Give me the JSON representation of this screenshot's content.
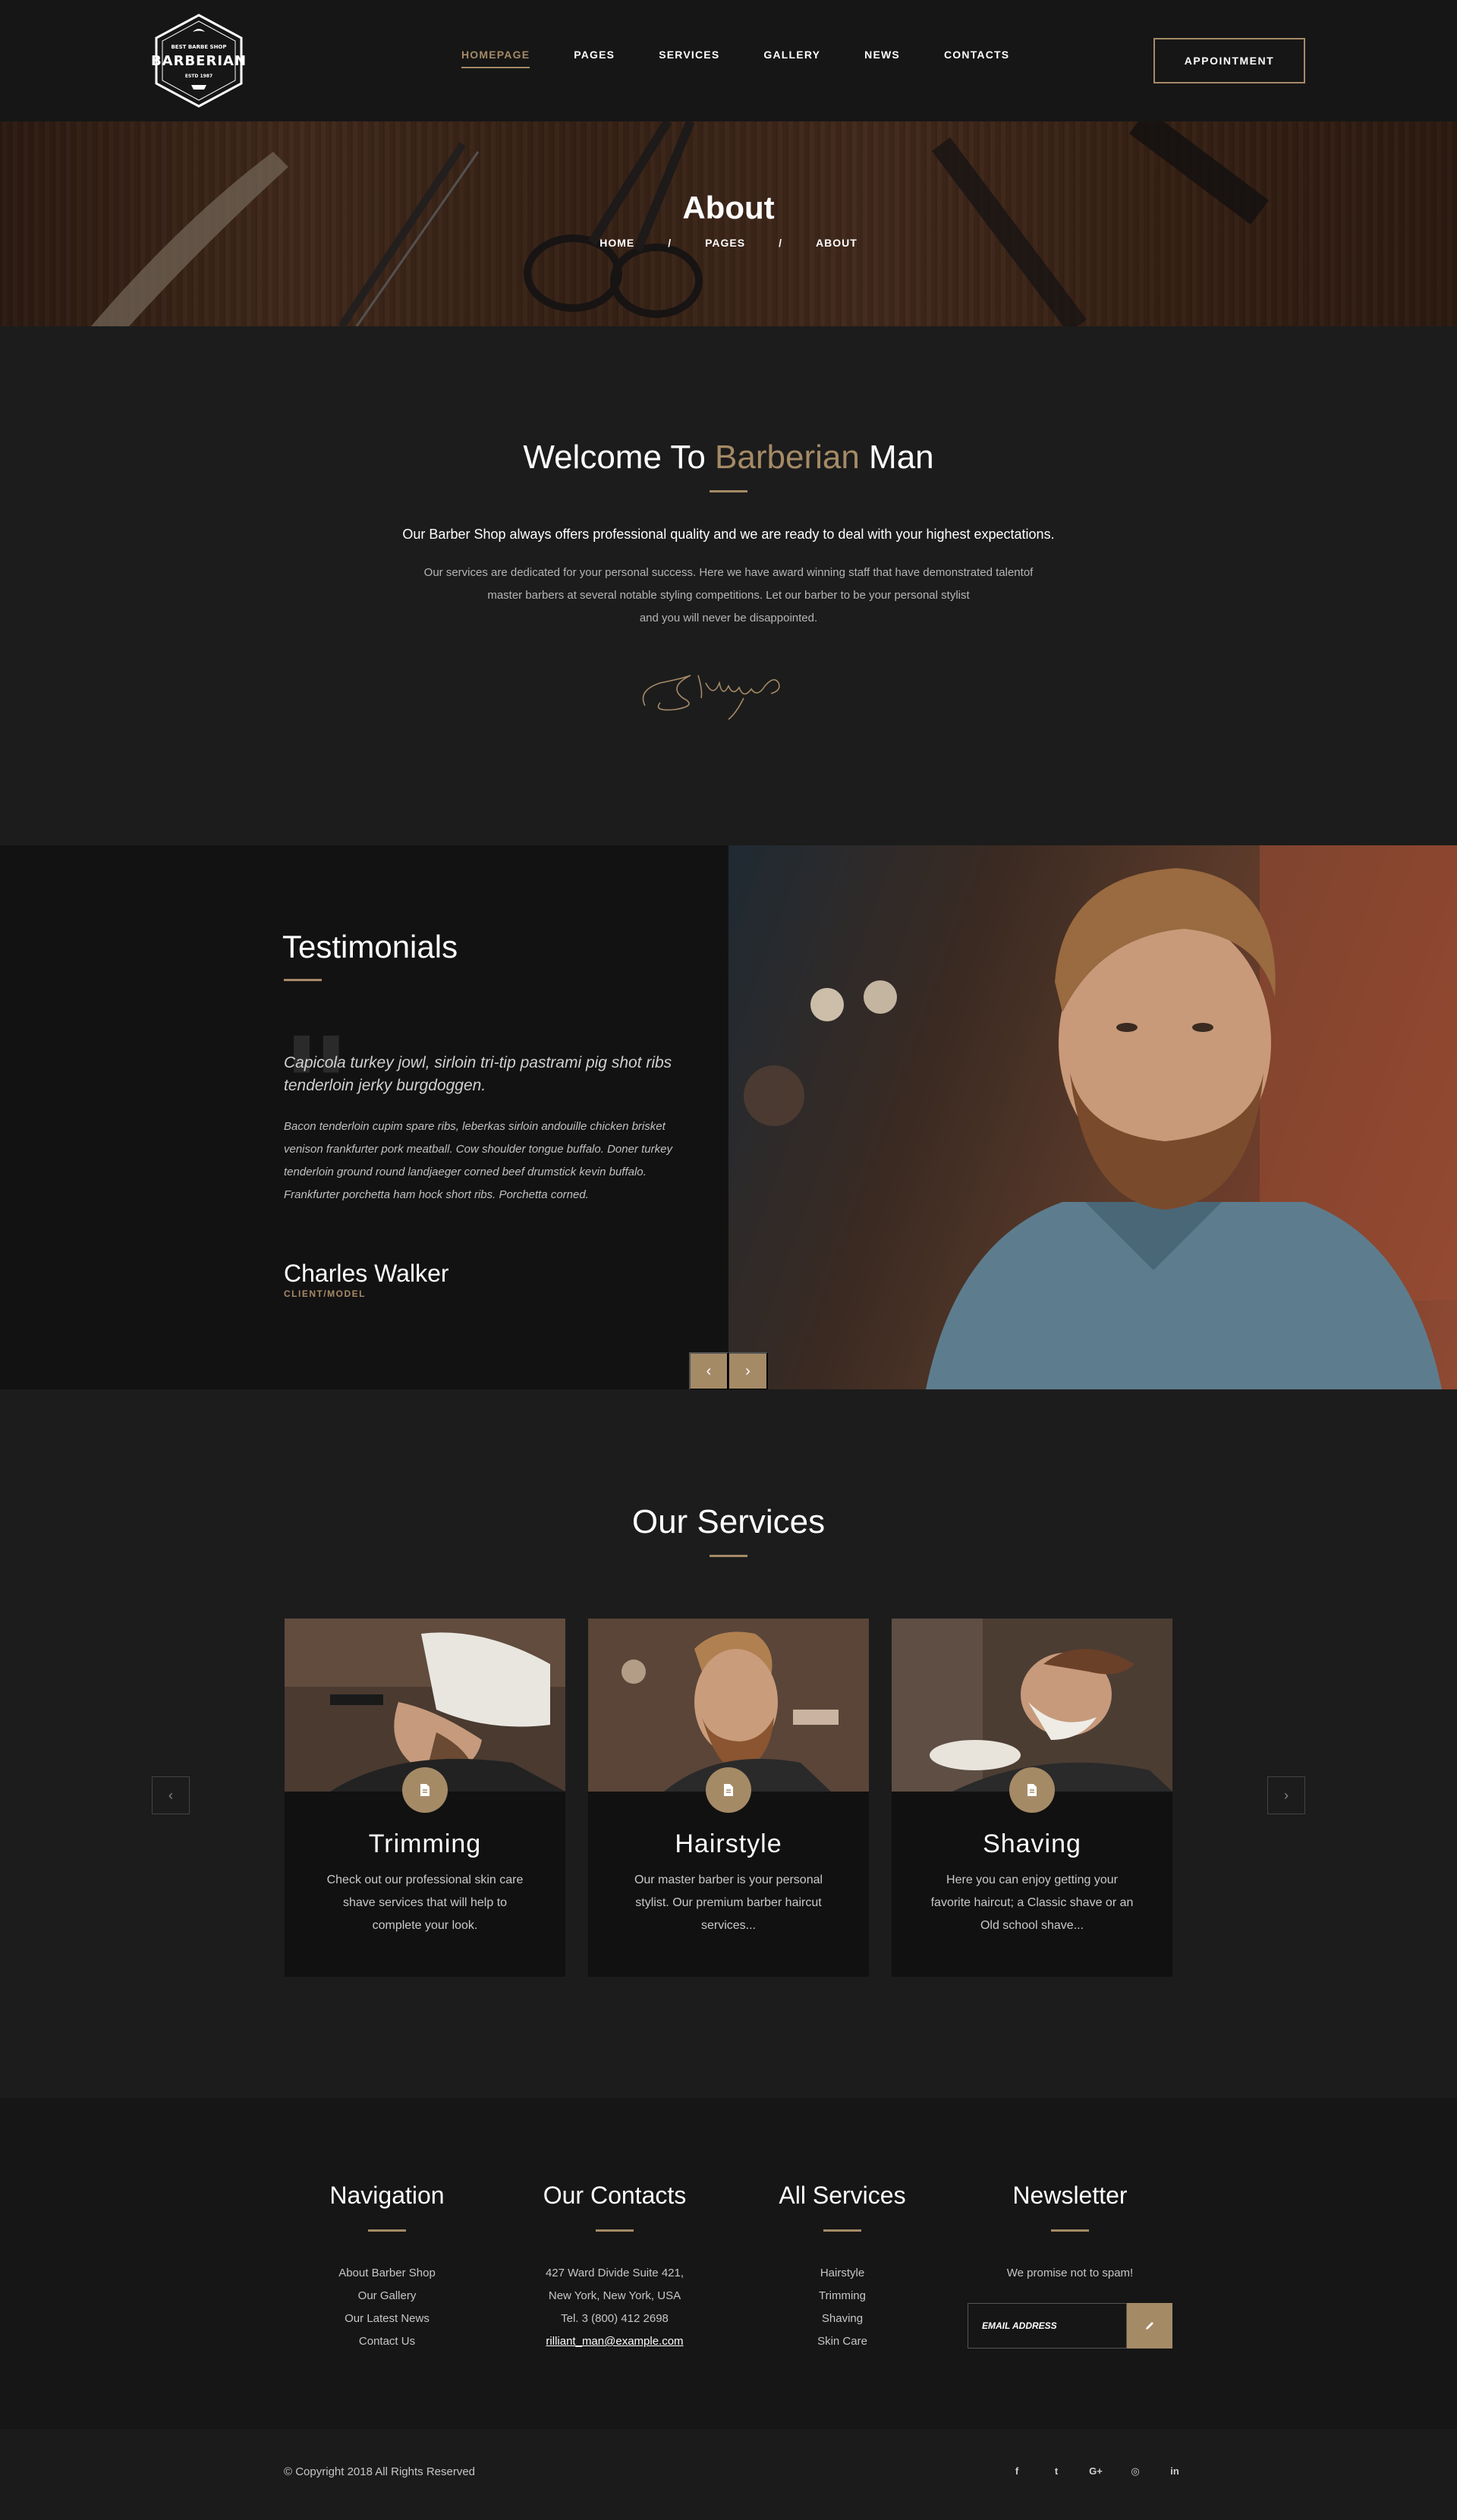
{
  "header": {
    "logo": {
      "top_text": "BEST BARBE SHOP",
      "brand": "BARBERIAN",
      "bottom_text": "ESTD 1987"
    },
    "nav": [
      {
        "label": "HOMEPAGE",
        "active": true
      },
      {
        "label": "PAGES",
        "active": false
      },
      {
        "label": "SERVICES",
        "active": false
      },
      {
        "label": "GALLERY",
        "active": false
      },
      {
        "label": "NEWS",
        "active": false
      },
      {
        "label": "CONTACTS",
        "active": false
      }
    ],
    "appointment_label": "APPOINTMENT"
  },
  "hero": {
    "title": "About",
    "breadcrumb": [
      "HOME",
      "/",
      "PAGES",
      "/",
      "ABOUT"
    ]
  },
  "welcome": {
    "title_prefix": "Welcome To ",
    "title_accent": "Barberian",
    "title_suffix": " Man",
    "lead": "Our Barber Shop always offers professional quality and we are ready to deal with your highest expectations.",
    "body_lines": [
      "Our services are dedicated for your personal success. Here we have award winning staff that have demonstrated talentof",
      "master barbers at several notable styling competitions. Let our barber to be your personal stylist",
      "and you will never be disappointed."
    ]
  },
  "testimonials": {
    "title": "Testimonials",
    "quote": "Capicola turkey jowl, sirloin tri-tip pastrami pig shot ribs tenderloin jerky burgdoggen.",
    "text": "Bacon tenderloin cupim spare ribs, leberkas sirloin andouille chicken brisket venison frankfurter pork meatball. Cow shoulder tongue buffalo. Doner turkey tenderloin ground round landjaeger corned beef drumstick kevin buffalo. Frankfurter porchetta ham hock short ribs. Porchetta corned.",
    "name": "Charles Walker",
    "role": "CLIENT/MODEL",
    "prev": "‹",
    "next": "›"
  },
  "services": {
    "title": "Our Services",
    "prev": "‹",
    "next": "›",
    "cards": [
      {
        "title": "Trimming",
        "desc": "Check out our professional skin care shave services that will help to complete your look.",
        "icon": "document-icon"
      },
      {
        "title": "Hairstyle",
        "desc": "Our master barber is your personal stylist. Our premium barber haircut services...",
        "icon": "document-icon"
      },
      {
        "title": "Shaving",
        "desc": "Here you can enjoy getting your favorite haircut; a Classic shave or an Old school shave...",
        "icon": "document-icon"
      }
    ]
  },
  "footer": {
    "navigation": {
      "title": "Navigation",
      "items": [
        "About Barber Shop",
        "Our Gallery",
        "Our Latest News",
        "Contact Us"
      ]
    },
    "contacts": {
      "title": "Our Contacts",
      "items": [
        "427 Ward Divide Suite 421,",
        "New York, New York, USA",
        "Tel. 3 (800) 412 2698"
      ],
      "email": "rilliant_man@example.com"
    },
    "services": {
      "title": "All Services",
      "items": [
        "Hairstyle",
        "Trimming",
        "Shaving",
        "Skin Care"
      ]
    },
    "newsletter": {
      "title": "Newsletter",
      "note": "We promise not to spam!",
      "placeholder": "EMAIL ADDRESS"
    }
  },
  "bottom": {
    "copyright": "© Copyright 2018 All Rights Reserved",
    "socials": [
      {
        "label": "f",
        "icon": "facebook-icon"
      },
      {
        "label": "t",
        "icon": "twitter-icon"
      },
      {
        "label": "G+",
        "icon": "google-plus-icon"
      },
      {
        "label": "◎",
        "icon": "instagram-icon"
      },
      {
        "label": "in",
        "icon": "linkedin-icon"
      }
    ]
  },
  "colors": {
    "accent": "#a58a66",
    "background": "#1c1c1c",
    "dark": "#131213"
  }
}
